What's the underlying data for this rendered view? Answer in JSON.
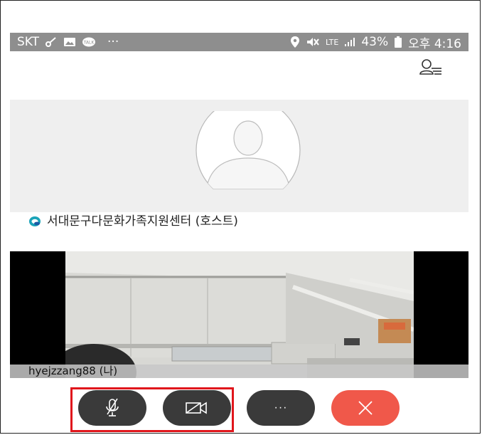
{
  "status_bar": {
    "carrier": "SKT",
    "more": "···",
    "network": "LTE",
    "battery_percent": "43%",
    "time": "오후 4:16",
    "icons_left": [
      "key-icon",
      "image-icon",
      "talk-icon"
    ],
    "icons_right": [
      "location-icon",
      "mute-icon",
      "battery-icon"
    ]
  },
  "header": {
    "participants_icon": "participants-icon"
  },
  "host": {
    "name": "서대문구다문화가족지원센터 (호스트)"
  },
  "self_video": {
    "name_label": "hyejzzang88 (나)"
  },
  "controls": {
    "mic": "mic-muted-icon",
    "camera": "camera-off-icon",
    "more": "···",
    "end_call": "close-icon"
  },
  "colors": {
    "status_bar_bg": "#8e8e8e",
    "end_call_red": "#f0584a",
    "control_dark": "#3a3a3a",
    "highlight_border": "#e0161c"
  }
}
